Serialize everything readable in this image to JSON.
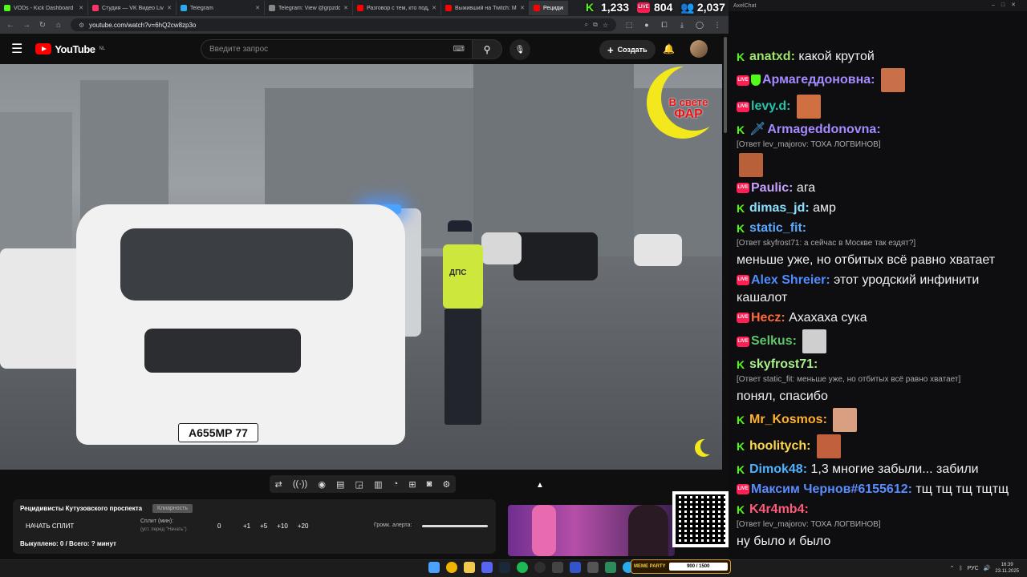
{
  "tabs": [
    {
      "label": "VODs - Kick Dashboard",
      "color": "#53fc18"
    },
    {
      "label": "Студия — VK Видео Live",
      "color": "#ff3366"
    },
    {
      "label": "Telegram",
      "color": "#2aabee"
    },
    {
      "label": "Telegram: View @grpzdc",
      "color": "#888888"
    },
    {
      "label": "Разговор с тем, кто поддер",
      "color": "#ff0000"
    },
    {
      "label": "Выживший на Twitch: Мар",
      "color": "#ff0000"
    },
    {
      "label": "Рецидив",
      "color": "#ff0000"
    }
  ],
  "url": "youtube.com/watch?v=6hQ2cw8zp3o",
  "youtube": {
    "region": "NL",
    "logo_text": "YouTube",
    "search_placeholder": "Введите запрос",
    "create_label": "Создать"
  },
  "stats": {
    "kick": "1,233",
    "vk": "804",
    "total": "2,037"
  },
  "watermark": {
    "line1": "В свете",
    "line2": "ФАР"
  },
  "plate": "А655МР 77",
  "panel": {
    "title": "Рецидивисты Кутузовского проспекта",
    "tag": "Клиарность",
    "start_split": "НАЧАТЬ СПЛИТ",
    "split_label": "Сплит (мин):",
    "split_hint": "(уст. перед \"Начать\")",
    "split_value": "0",
    "increments": [
      "+1",
      "+5",
      "+10",
      "+20"
    ],
    "volume_label": "Громк. алерта:",
    "summary": "Выкуплено: 0 / Всего: ? минут"
  },
  "chat": {
    "title": "AxelChat",
    "messages": [
      {
        "platform": "kick",
        "nick": "anatxd:",
        "color": "#9ee66a",
        "text": "какой крутой"
      },
      {
        "platform": "vk",
        "nick": "Армагеддоновна:",
        "color": "#a48bff",
        "text": "",
        "shield": true,
        "emote": "#c9704a"
      },
      {
        "platform": "vk",
        "nick": "levy.d:",
        "color": "#27c2a8",
        "text": "",
        "emote": "#d07040"
      },
      {
        "platform": "kick",
        "nick": "Armageddonovna:",
        "color": "#a48bff",
        "text": "",
        "reply": "[Ответ lev_majorov: ТОХА ЛОГВИНОВ]",
        "emote": "#b8603a",
        "sword": true
      },
      {
        "platform": "vk",
        "nick": "Paulic:",
        "color": "#c6a0ff",
        "text": "ага"
      },
      {
        "platform": "kick",
        "nick": "dimas_jd:",
        "color": "#8ce0ff",
        "text": "амр"
      },
      {
        "platform": "kick",
        "nick": "static_fit:",
        "color": "#5aa9ff",
        "text": "меньше уже, но отбитых всё равно хватает",
        "reply": "[Ответ skyfrost71: а сейчас в Москве так ездят?]"
      },
      {
        "platform": "vk",
        "nick": "Alex Shreier:",
        "color": "#4f8bff",
        "text": "этот уродский инфинити кашалот"
      },
      {
        "platform": "vk",
        "nick": "Hecz:",
        "color": "#ff6a3d",
        "text": "Ахахаха сука"
      },
      {
        "platform": "vk",
        "nick": "Selkus:",
        "color": "#5ec46a",
        "text": "",
        "emote": "#cfcfcf"
      },
      {
        "platform": "kick",
        "nick": "skyfrost71:",
        "color": "#a9f08a",
        "text": "понял, спасибо",
        "reply": "[Ответ static_fit: меньше уже, но отбитых всё равно хватает]"
      },
      {
        "platform": "kick",
        "nick": "Mr_Kosmos:",
        "color": "#ffb02e",
        "text": "",
        "emote": "#d8a080"
      },
      {
        "platform": "kick",
        "nick": "hoolitych:",
        "color": "#ffd84a",
        "text": "",
        "emote": "#c0603c"
      },
      {
        "platform": "kick",
        "nick": "Dimok48:",
        "color": "#4fb2ff",
        "text": "1,3 многие забыли... забили"
      },
      {
        "platform": "vk",
        "nick": "Максим Чернов#6155612:",
        "color": "#5a8cff",
        "text": "тщ тщ тщ тщтщ"
      },
      {
        "platform": "kick",
        "nick": "K4r4mb4:",
        "color": "#ff5a7a",
        "text": "ну было и было",
        "reply": "[Ответ lev_majorov: ТОХА ЛОГВИНОВ]"
      }
    ]
  },
  "meme_party": {
    "label": "MEME PARTY",
    "progress": "900 / 1500"
  },
  "tray": {
    "lang": "РУС",
    "time": "16:39",
    "date": "23.11.2025"
  },
  "badges": {
    "vk": "LIVE",
    "kick": "K"
  }
}
